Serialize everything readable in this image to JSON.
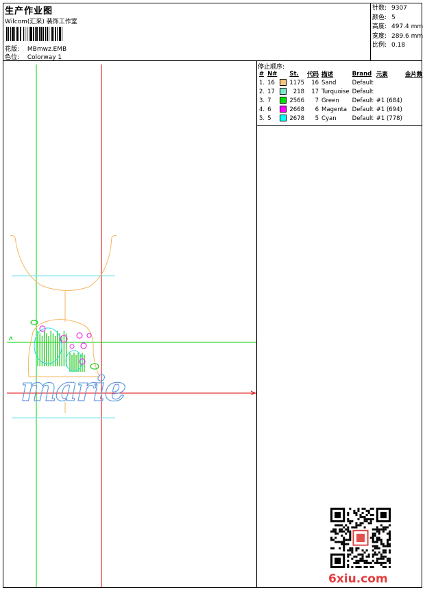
{
  "header": {
    "title": "生产作业图",
    "company": "Wilcom(汇采) 装饰工作室",
    "design_label": "花版:",
    "design_value": "MBmwz.EMB",
    "colorway_label": "色位:",
    "colorway_value": "Colorway 1"
  },
  "stats": [
    {
      "label": "针数:",
      "value": "9307"
    },
    {
      "label": "颜色:",
      "value": "5"
    },
    {
      "label": "高度:",
      "value": "497.4 mm"
    },
    {
      "label": "宽度:",
      "value": "289.6 mm"
    },
    {
      "label": "比例:",
      "value": "0.18"
    }
  ],
  "stop_sequence": {
    "title": "停止顺序:",
    "columns": [
      "#",
      "N#",
      "St.",
      "代码",
      "描述",
      "Brand",
      "元素",
      "金片数"
    ],
    "rows": [
      {
        "idx": "1.",
        "n": "16",
        "color": "#f9c67f",
        "st": "1175",
        "code": "16",
        "desc": "Sand",
        "brand": "Default",
        "elem": "",
        "sequins": ""
      },
      {
        "idx": "2.",
        "n": "17",
        "color": "#7ee8cc",
        "st": "218",
        "code": "17",
        "desc": "Turquoise",
        "brand": "Default",
        "elem": "",
        "sequins": ""
      },
      {
        "idx": "3.",
        "n": "7",
        "color": "#00e000",
        "st": "2566",
        "code": "7",
        "desc": "Green",
        "brand": "Default",
        "elem": "#1 (684)",
        "sequins": ""
      },
      {
        "idx": "4.",
        "n": "6",
        "color": "#ff00ff",
        "st": "2668",
        "code": "6",
        "desc": "Magenta",
        "brand": "Default",
        "elem": "#1 (694)",
        "sequins": ""
      },
      {
        "idx": "5.",
        "n": "5",
        "color": "#00ffff",
        "st": "2678",
        "code": "5",
        "desc": "Cyan",
        "brand": "Default",
        "elem": "#1 (778)",
        "sequins": ""
      }
    ]
  },
  "design_preview": {
    "text": "marie",
    "colors": {
      "outline": "#f6b45e",
      "guide_green": "#00d000",
      "guide_red": "#e00000",
      "guide_cyan": "#6ee0ee",
      "green": "#22cc22",
      "magenta": "#e633e6",
      "cyan": "#22dddd"
    }
  },
  "watermark": "6xiu.com"
}
